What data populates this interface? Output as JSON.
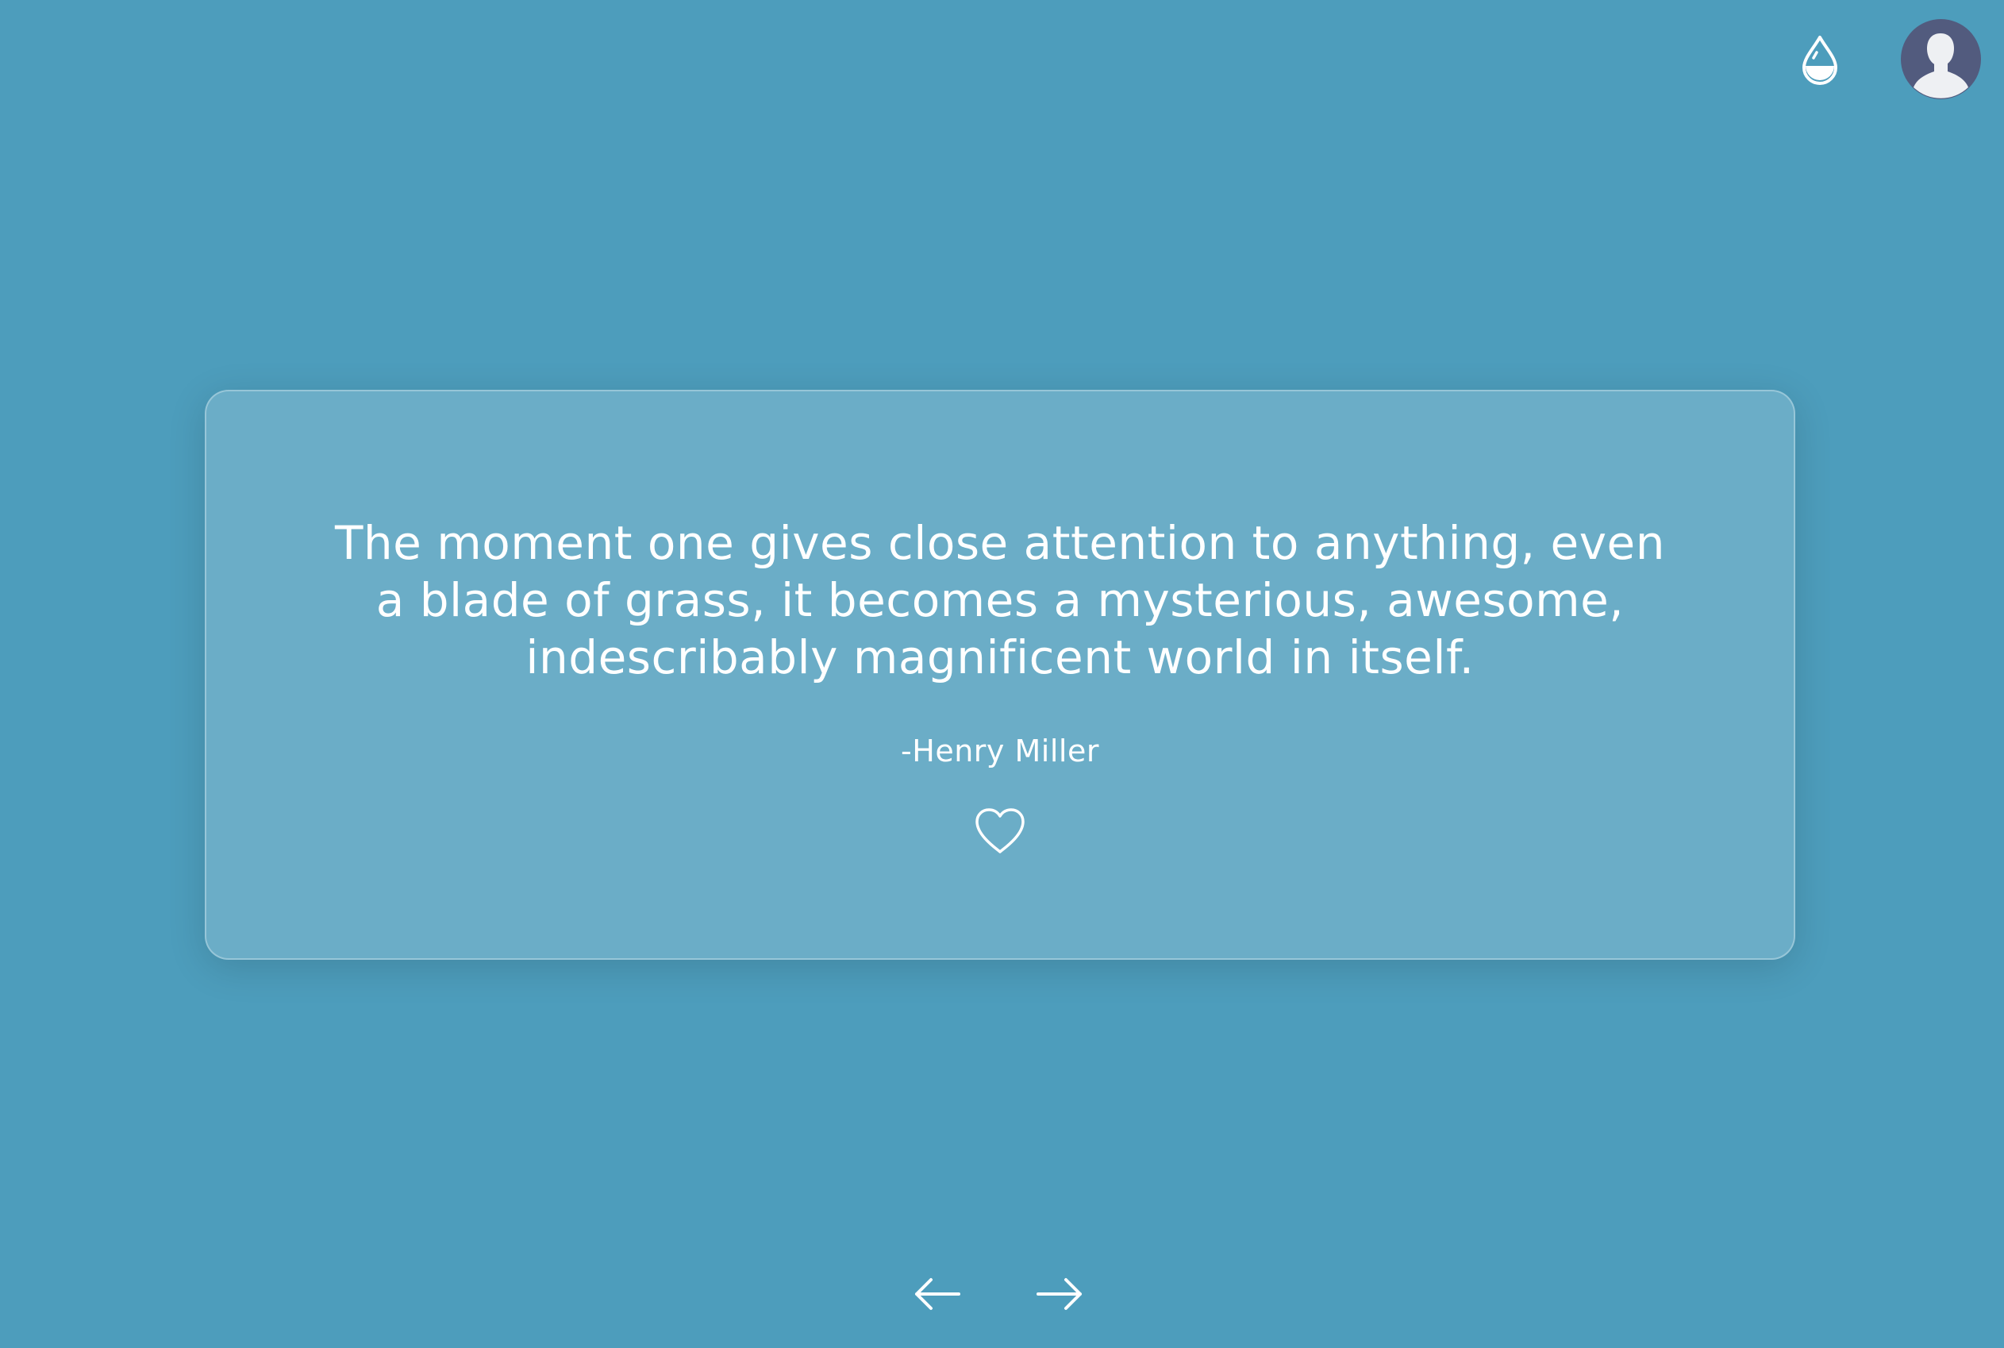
{
  "header": {
    "theme_icon": "water-drop-icon",
    "avatar_icon": "user-silhouette-icon"
  },
  "quote": {
    "text": "The moment one gives close attention to anything, even a blade of grass, it becomes a mysterious, awesome, indescribably magnificent world in itself.",
    "author": "-Henry Miller",
    "like_icon": "heart-outline-icon"
  },
  "navigation": {
    "prev_icon": "arrow-left-icon",
    "next_icon": "arrow-right-icon"
  },
  "colors": {
    "background": "#4d9dbc",
    "card": "#6eadc8",
    "avatar_bg": "#525b7e",
    "foreground": "#ffffff"
  }
}
